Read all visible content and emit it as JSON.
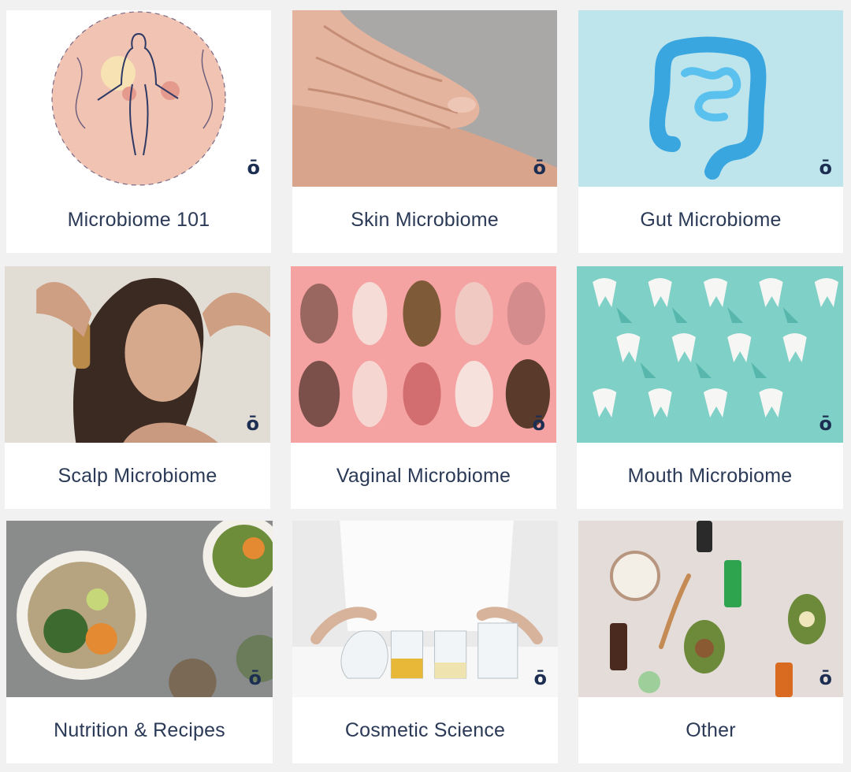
{
  "brand_mark": "ō",
  "categories": [
    {
      "label": "Microbiome 101",
      "image": "microbiome-illustration"
    },
    {
      "label": "Skin Microbiome",
      "image": "skin-hand-photo"
    },
    {
      "label": "Gut Microbiome",
      "image": "gut-model-photo"
    },
    {
      "label": "Scalp Microbiome",
      "image": "scalp-woman-photo"
    },
    {
      "label": "Vaginal Microbiome",
      "image": "vaginal-illustration"
    },
    {
      "label": "Mouth Microbiome",
      "image": "teeth-pattern-photo"
    },
    {
      "label": "Nutrition & Recipes",
      "image": "food-bowls-photo"
    },
    {
      "label": "Cosmetic Science",
      "image": "lab-glassware-photo"
    },
    {
      "label": "Other",
      "image": "skincare-flatlay-photo"
    }
  ],
  "colors": {
    "label_text": "#2b3a57",
    "brand_mark": "#1c2e52",
    "page_bg": "#f1f1f2",
    "card_bg": "#ffffff"
  }
}
